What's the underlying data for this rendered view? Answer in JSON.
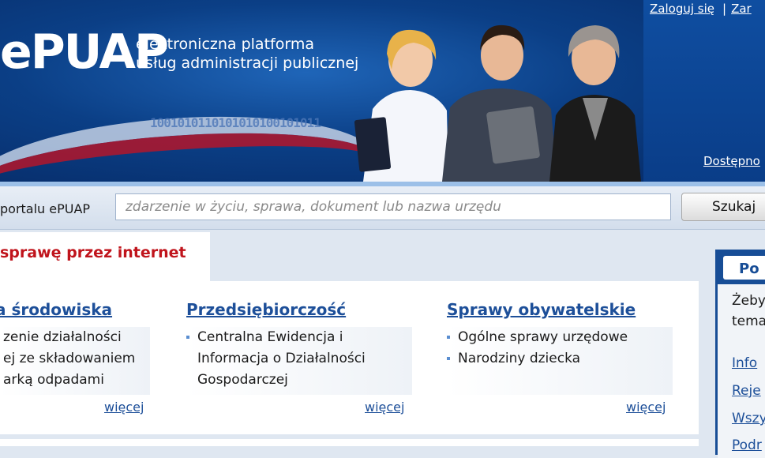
{
  "header": {
    "logo": "ePUAP",
    "tagline_line1": "elektroniczna platforma",
    "tagline_line2": "usług administracji publicznej",
    "binary_text": "1001010110101010100101011",
    "login_link": "Zaloguj się",
    "separator": "|",
    "register_link": "Zar",
    "accessibility_link": "Dostępno"
  },
  "search": {
    "label": "portalu ePUAP",
    "placeholder": "zdarzenie w życiu, sprawa, dokument lub nazwa urzędu",
    "value": "",
    "button_label": "Szukaj"
  },
  "main": {
    "heading": "sprawę przez internet",
    "columns": [
      {
        "title": "a środowiska",
        "items": [
          "zenie działalności",
          "ej ze składowaniem",
          "arką odpadami"
        ],
        "more": "więcej"
      },
      {
        "title": "Przedsiębiorczość",
        "items": [
          "Centralna Ewidencja i",
          "Informacja o Działalności",
          "Gospodarczej"
        ],
        "more": "więcej"
      },
      {
        "title": "Sprawy obywatelskie",
        "items": [
          "Ogólne sprawy urzędowe",
          "Narodziny dziecka"
        ],
        "more": "więcej"
      }
    ]
  },
  "right_box": {
    "title": "Po",
    "text_line1": "Żeby",
    "text_line2": "tema",
    "links": [
      "Info",
      "Reje",
      "Wszy",
      "Podr"
    ]
  },
  "colors": {
    "header_blue": "#0b3f86",
    "link_blue": "#1d4f99",
    "heading_red": "#c0141c"
  }
}
